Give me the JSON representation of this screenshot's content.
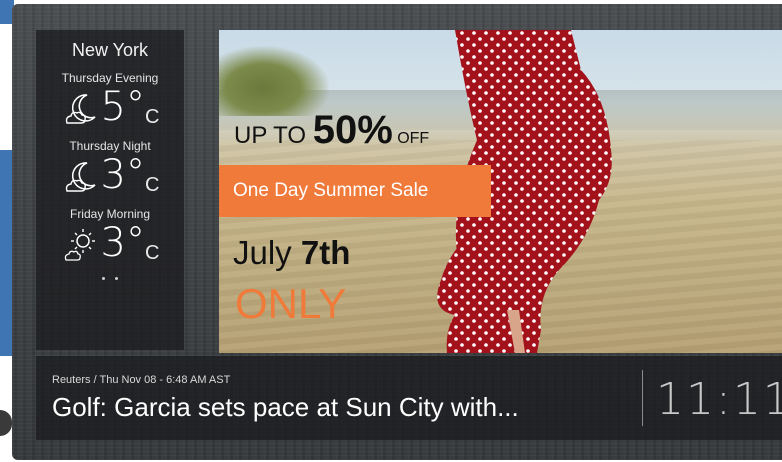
{
  "weather": {
    "city": "New York",
    "forecast": [
      {
        "label": "Thursday Evening",
        "temp": "5",
        "degree": "°",
        "unit": "C",
        "icon": "moon-cloud-icon"
      },
      {
        "label": "Thursday Night",
        "temp": "3",
        "degree": "°",
        "unit": "C",
        "icon": "moon-cloud-icon"
      },
      {
        "label": "Friday Morning",
        "temp": "3",
        "degree": "°",
        "unit": "C",
        "icon": "sun-cloud-icon"
      }
    ]
  },
  "ad": {
    "line1_prefix": "UP TO ",
    "line1_big": "50%",
    "line1_suffix": " OFF",
    "sale_label": "One Day Summer Sale",
    "date_prefix": "July ",
    "date_num": "7th",
    "only": "ONLY"
  },
  "ticker": {
    "source": "Reuters / Thu Nov 08 - 6:48 AM AST",
    "headline": "Golf: Garcia sets pace at Sun City with..."
  },
  "clock": {
    "time": "11:11"
  },
  "colors": {
    "accent_orange": "#f07a3a",
    "panel_dark": "#19191c",
    "page_blue": "#3f75b2"
  }
}
